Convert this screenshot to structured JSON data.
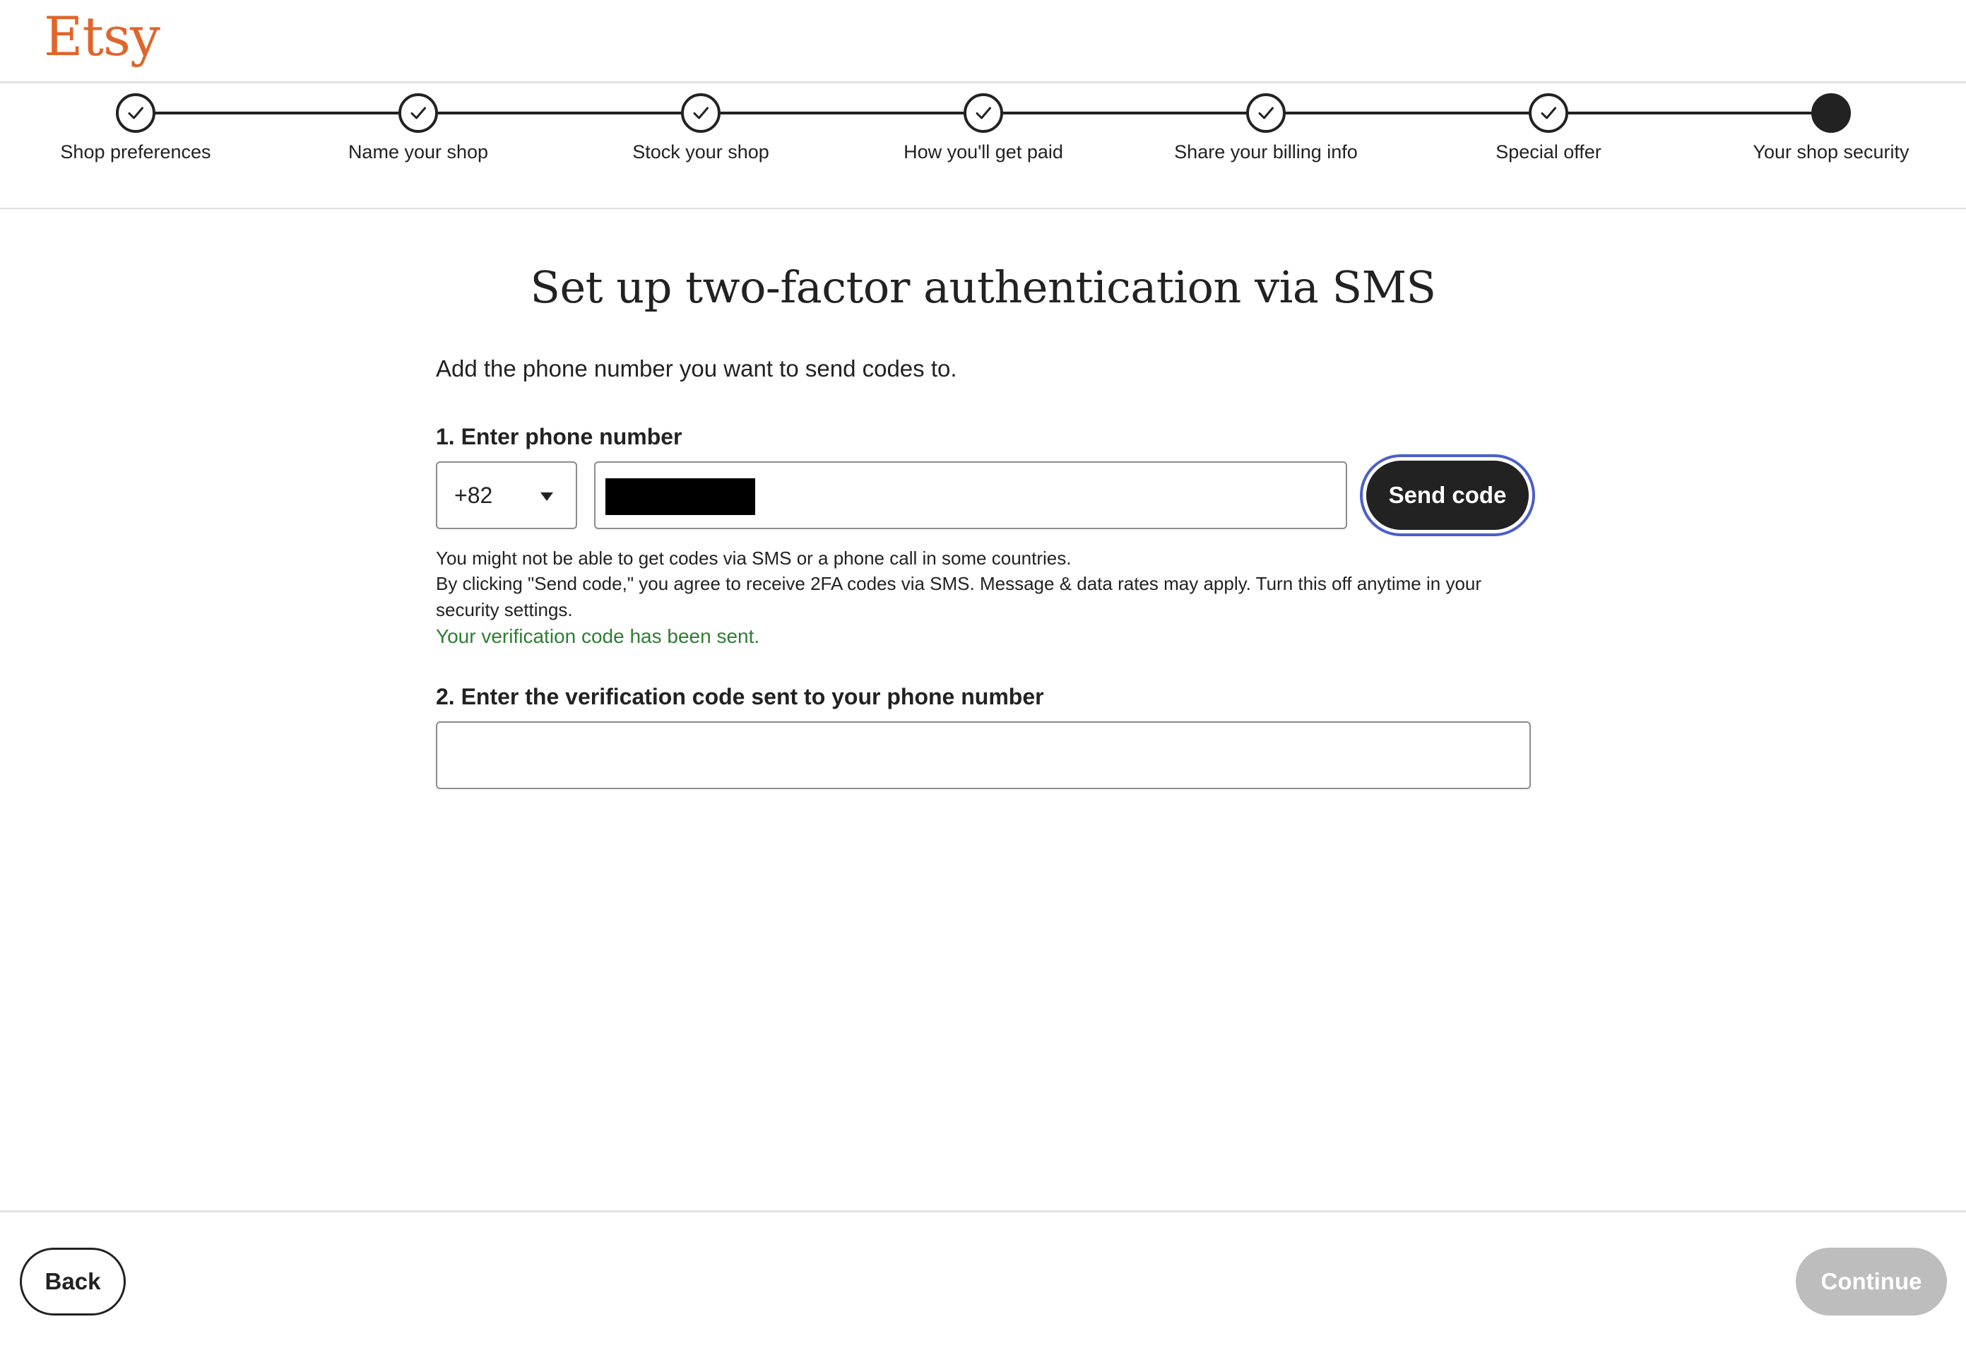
{
  "header": {
    "logo_text": "Etsy",
    "logo_color": "#e0652b"
  },
  "stepper": {
    "steps": [
      {
        "label": "Shop preferences",
        "status": "completed"
      },
      {
        "label": "Name your shop",
        "status": "completed"
      },
      {
        "label": "Stock your shop",
        "status": "completed"
      },
      {
        "label": "How you'll get paid",
        "status": "completed"
      },
      {
        "label": "Share your billing info",
        "status": "completed"
      },
      {
        "label": "Special offer",
        "status": "completed"
      },
      {
        "label": "Your shop security",
        "status": "current"
      }
    ]
  },
  "main": {
    "title": "Set up two-factor authentication via SMS",
    "intro": "Add the phone number you want to send codes to.",
    "phone_section": {
      "label": "1. Enter phone number",
      "country_code": "+82",
      "phone_value": "",
      "send_button": "Send code"
    },
    "notes": {
      "line1": "You might not be able to get codes via SMS or a phone call in some countries.",
      "line2": "By clicking \"Send code,\" you agree to receive 2FA codes via SMS. Message & data rates may apply. Turn this off anytime in your security settings.",
      "success": "Your verification code has been sent."
    },
    "code_section": {
      "label": "2. Enter the verification code sent to your phone number",
      "code_value": ""
    }
  },
  "footer": {
    "back_label": "Back",
    "continue_label": "Continue"
  },
  "colors": {
    "primary": "#222222",
    "focus_ring": "#4b5fc9",
    "success": "#2e7d32",
    "disabled": "#bdbdbd"
  }
}
